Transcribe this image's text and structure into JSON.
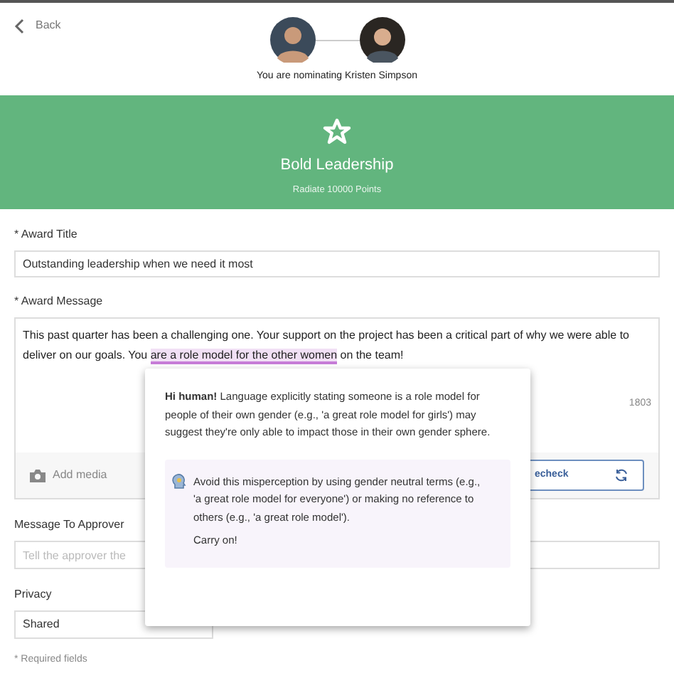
{
  "header": {
    "back": "Back",
    "nominating": "You are nominating Kristen Simpson"
  },
  "award": {
    "title": "Bold Leadership",
    "points": "Radiate 10000 Points"
  },
  "award_title": {
    "label": "* Award Title",
    "value": "Outstanding leadership when we need it most"
  },
  "award_message": {
    "label": "* Award Message",
    "value": "This past quarter has been a challenging one. Your support on the project has been a critical part of why we were able to deliver on our goals. You ",
    "highlight": "are a role model for the other women",
    "after": " on the team!",
    "count": "1803",
    "add_media": "Add media",
    "recheck": "echeck"
  },
  "message_to_approver": {
    "label": "Message To Approver",
    "placeholder": "Tell the approver the"
  },
  "privacy": {
    "label": "Privacy",
    "value": "Shared"
  },
  "required_note": "* Required fields",
  "popover": {
    "message": "**Hi human!** Language explicitly stating someone is a role model for people of their own gender (e.g., 'a great role model for girls') may suggest they're only able to impact those in their own gender sphere.",
    "tip": "Avoid this misperception by using gender neutral terms (e.g., 'a great role model for everyone') or making no reference to others (e.g., 'a great role model').",
    "closing": "Carry on!"
  }
}
